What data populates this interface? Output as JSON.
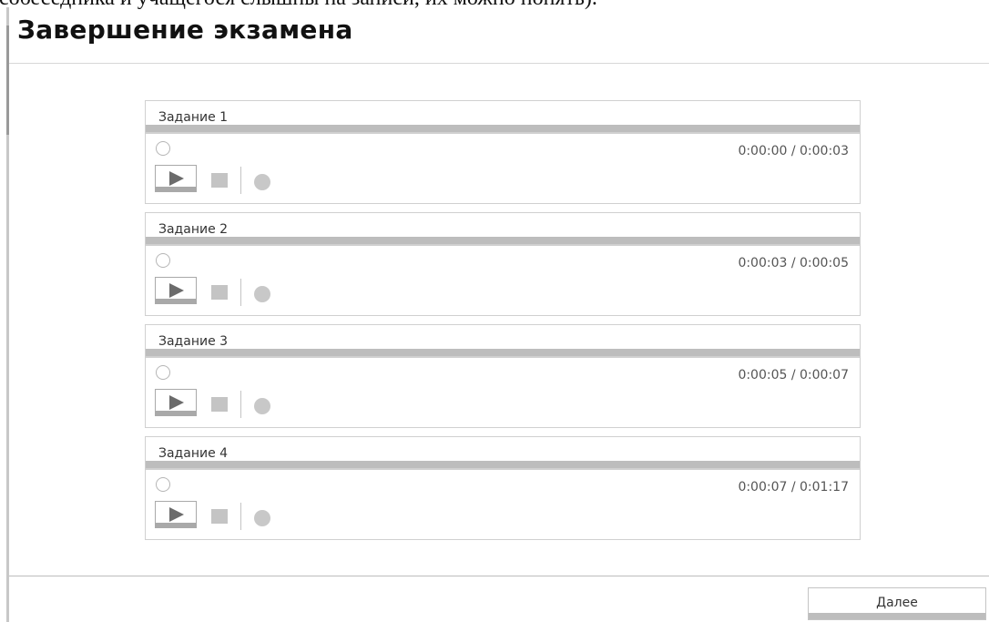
{
  "top_clipped_text": "собеседника и учащегося слышны на записи, их можно понять).",
  "page_title": "Завершение экзамена",
  "tasks": [
    {
      "label": "Задание 1",
      "time": "0:00:00 / 0:00:03"
    },
    {
      "label": "Задание 2",
      "time": "0:00:03 / 0:00:05"
    },
    {
      "label": "Задание 3",
      "time": "0:00:05 / 0:00:07"
    },
    {
      "label": "Задание 4",
      "time": "0:00:07 / 0:01:17"
    }
  ],
  "controls": {
    "play_icon": "play-icon",
    "stop_icon": "stop-icon",
    "record_icon": "record-icon",
    "loading_icon": "loading-icon"
  },
  "footer": {
    "next_label": "Далее"
  },
  "colors": {
    "bar": "#bdbdbd",
    "border": "#d0d0d0",
    "text": "#333333"
  }
}
